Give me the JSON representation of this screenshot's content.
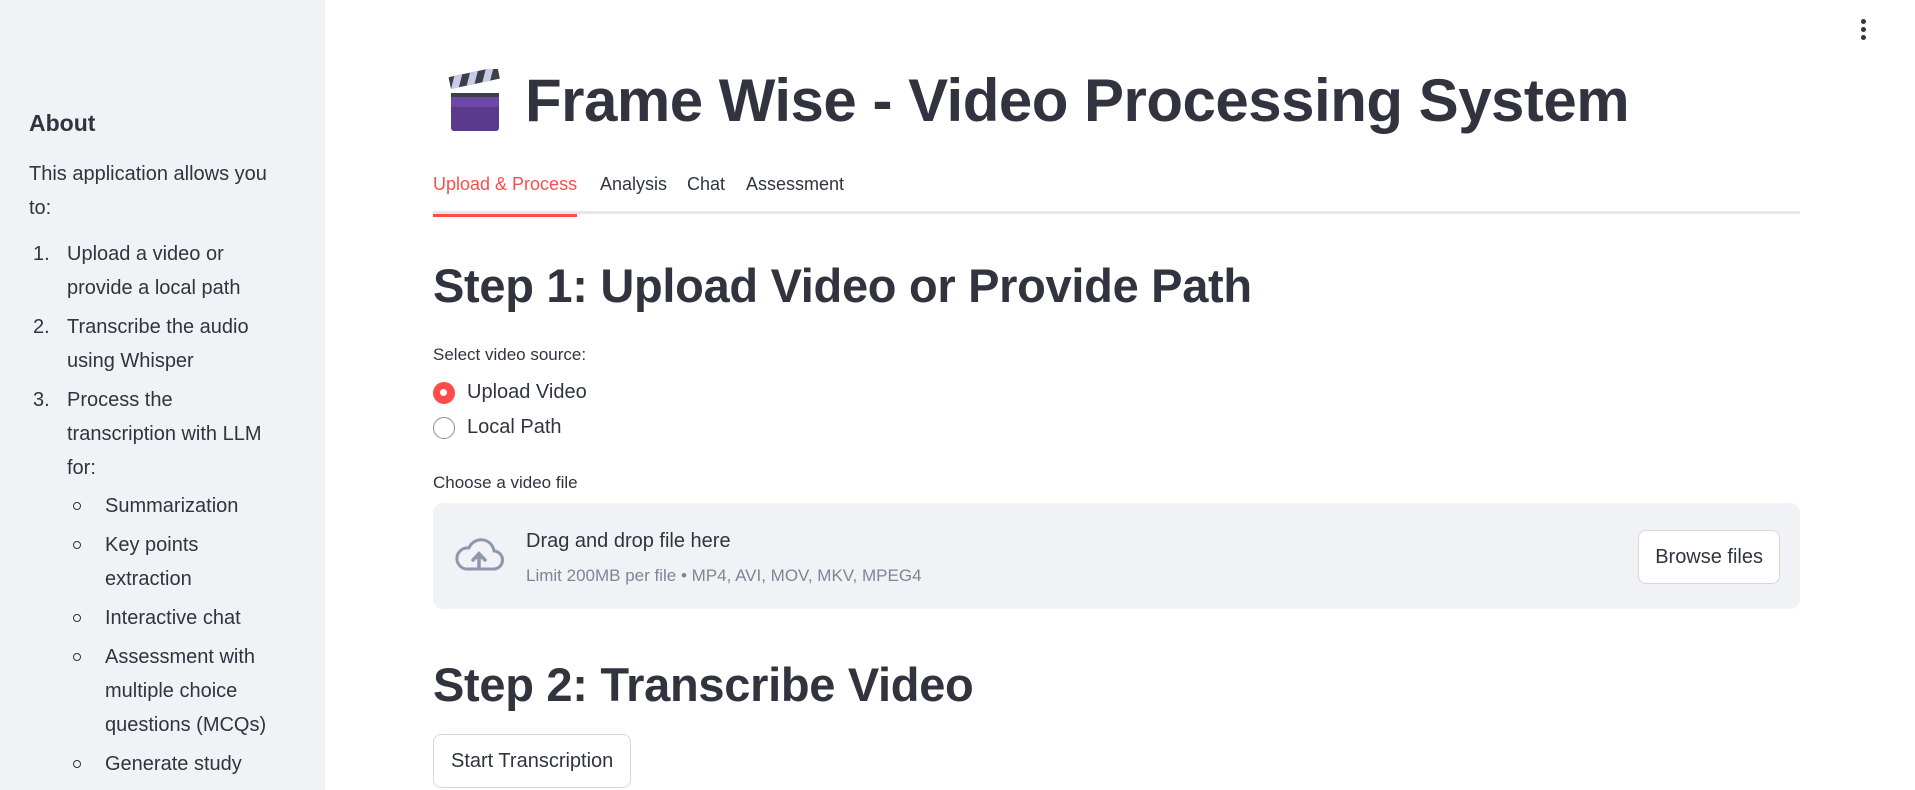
{
  "sidebar": {
    "title": "About",
    "intro": "This application allows you to:",
    "items": [
      {
        "num": "1.",
        "label": "Upload a video or provide a local path"
      },
      {
        "num": "2.",
        "label": "Transcribe the audio using Whisper"
      },
      {
        "num": "3.",
        "label": "Process the transcription with LLM for:"
      }
    ],
    "subitems": [
      "Summarization",
      "Key points extraction",
      "Interactive chat",
      "Assessment with multiple choice questions (MCQs)",
      "Generate study"
    ]
  },
  "header": {
    "icon": "clapper-board-icon",
    "title": "Frame Wise - Video Processing System"
  },
  "tabs": [
    {
      "label": "Upload & Process",
      "active": true
    },
    {
      "label": "Analysis",
      "active": false
    },
    {
      "label": "Chat",
      "active": false
    },
    {
      "label": "Assessment",
      "active": false
    }
  ],
  "step1": {
    "heading": "Step 1: Upload Video or Provide Path",
    "source_label": "Select video source:",
    "options": [
      {
        "label": "Upload Video",
        "selected": true
      },
      {
        "label": "Local Path",
        "selected": false
      }
    ],
    "file_label": "Choose a video file",
    "dropzone": {
      "icon": "cloud-upload-icon",
      "title": "Drag and drop file here",
      "subtitle": "Limit 200MB per file • MP4, AVI, MOV, MKV, MPEG4",
      "browse_label": "Browse files"
    }
  },
  "step2": {
    "heading": "Step 2: Transcribe Video",
    "button_label": "Start Transcription"
  },
  "colors": {
    "accent": "#ff4b4b",
    "sidebar_bg": "#f0f2f6",
    "text": "#31333f",
    "muted": "#808495"
  }
}
